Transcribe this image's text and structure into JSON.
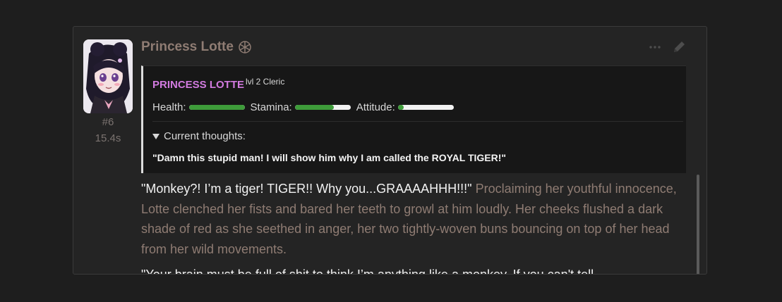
{
  "message": {
    "author_name": "Princess Lotte",
    "mes_id": "#6",
    "timer": "15.4s",
    "status": {
      "char_name": "PRINCESS LOTTE",
      "char_class": "lvl 2 Cleric",
      "stats": [
        {
          "label": "Health:",
          "value": 1.0
        },
        {
          "label": "Stamina:",
          "value": 0.7
        },
        {
          "label": "Attitude:",
          "value": 0.1
        }
      ],
      "thoughts_label": "Current thoughts:",
      "thoughts": "\"Damn this stupid man! I will show him why I am called the ROYAL TIGER!\""
    },
    "paragraphs": [
      {
        "quote": "\"Monkey?! I’m a tiger! TIGER!! Why you...GRAAAAHHH!!!\"",
        "narration": " Proclaiming her youthful innocence, Lotte clenched her fists and bared her teeth to growl at him loudly. Her cheeks flushed a dark shade of red as she seethed in anger, her two tightly-woven buns bouncing on top of her head from her wild movements."
      },
      {
        "quote": "\"Your brain must be full of shit to think I’m anything like a monkey. If you can't tell",
        "narration": ""
      }
    ],
    "colors": {
      "accent": "#d27be0",
      "bar_fill": "#3e9c3a",
      "narration": "#8f7c73",
      "quote": "#f2f2f2"
    }
  }
}
